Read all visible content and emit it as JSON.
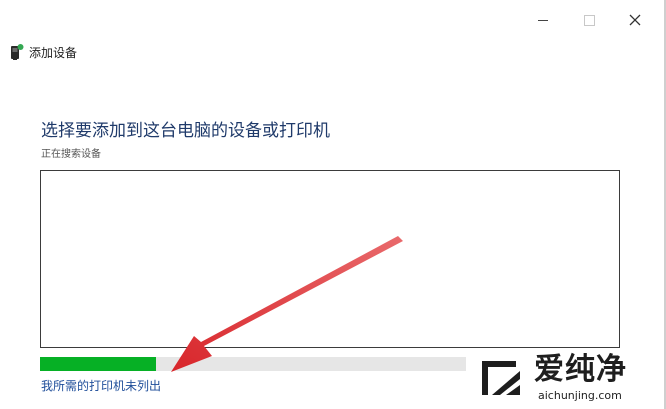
{
  "window": {
    "title": "添加设备",
    "controls": {
      "minimize": "minimize",
      "maximize": "maximize",
      "close": "close"
    }
  },
  "main": {
    "heading": "选择要添加到这台电脑的设备或打印机",
    "status": "正在搜索设备",
    "device_list": [],
    "progress": 0.2,
    "link_label": "我所需的打印机未列出"
  },
  "colors": {
    "heading": "#1f3a6a",
    "progress_fill": "#06b025",
    "progress_track": "#e6e6e6",
    "link": "#1f4e9a",
    "annotation_arrow": "#e0383c"
  },
  "icons": {
    "app": "printer-device-icon",
    "watermark": "aichunjing-logo-icon"
  },
  "watermark": {
    "brand": "爱纯净",
    "url": "aichunjing.com"
  }
}
